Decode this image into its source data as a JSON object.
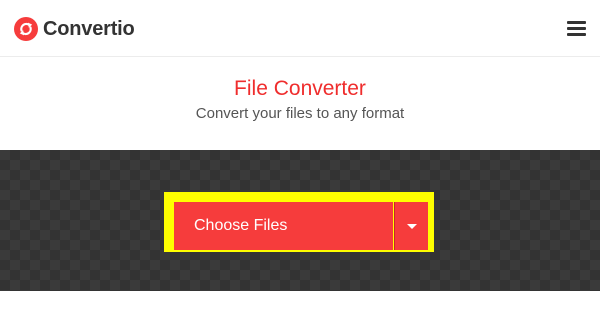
{
  "header": {
    "brand_name": "Convertio",
    "logo_icon": "convertio-logo-icon",
    "menu_icon": "hamburger-menu-icon"
  },
  "hero": {
    "title": "File Converter",
    "subtitle": "Convert your files to any format"
  },
  "upload": {
    "choose_label": "Choose Files",
    "dropdown_icon": "caret-down-icon"
  },
  "colors": {
    "brand_red": "#f63c3c",
    "title_red": "#ef2d2d",
    "highlight": "#ffff00",
    "band_dark": "#3a3a3a"
  }
}
